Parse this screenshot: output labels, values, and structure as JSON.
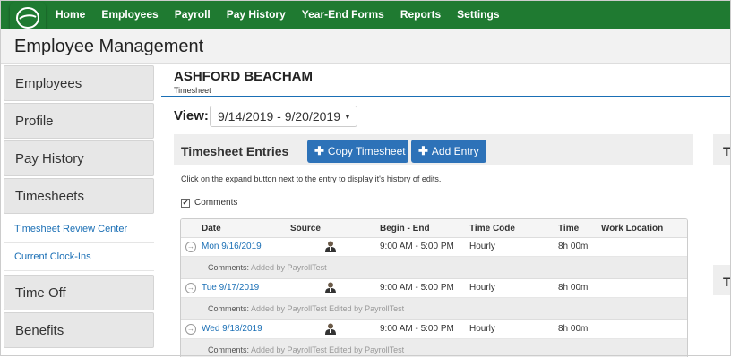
{
  "nav": [
    "Home",
    "Employees",
    "Payroll",
    "Pay History",
    "Year-End Forms",
    "Reports",
    "Settings"
  ],
  "page_title": "Employee Management",
  "sidebar": {
    "items": [
      {
        "label": "Employees"
      },
      {
        "label": "Profile"
      },
      {
        "label": "Pay History"
      },
      {
        "label": "Timesheets"
      }
    ],
    "subitems": [
      {
        "label": "Timesheet Review Center"
      },
      {
        "label": "Current Clock-Ins"
      }
    ],
    "items_after": [
      {
        "label": "Time Off"
      },
      {
        "label": "Benefits"
      }
    ]
  },
  "employee": {
    "name": "ASHFORD BEACHAM",
    "section": "Timesheet"
  },
  "view": {
    "label": "View:",
    "range": "9/14/2019 - 9/20/2019"
  },
  "entries_panel": {
    "title": "Timesheet Entries",
    "copy_label": "Copy Timesheet",
    "add_label": "Add Entry",
    "right_title_1": "T",
    "right_title_2": "T"
  },
  "hint": "Click on the expand button next to the entry to display it's history of edits.",
  "comments_label": "Comments",
  "table": {
    "headers": [
      "Date",
      "Source",
      "Begin - End",
      "Time Code",
      "Time",
      "Work Location"
    ],
    "rows": [
      {
        "date": "Mon 9/16/2019",
        "begin_end": "9:00 AM - 5:00 PM",
        "time_code": "Hourly",
        "time": "8h 00m",
        "location": "",
        "comment_label": "Comments:",
        "comment": "Added by PayrollTest"
      },
      {
        "date": "Tue 9/17/2019",
        "begin_end": "9:00 AM - 5:00 PM",
        "time_code": "Hourly",
        "time": "8h 00m",
        "location": "",
        "comment_label": "Comments:",
        "comment": "Added by PayrollTest Edited by PayrollTest"
      },
      {
        "date": "Wed 9/18/2019",
        "begin_end": "9:00 AM - 5:00 PM",
        "time_code": "Hourly",
        "time": "8h 00m",
        "location": "",
        "comment_label": "Comments:",
        "comment": "Added by PayrollTest Edited by PayrollTest"
      }
    ]
  },
  "colors": {
    "nav_green": "#1f7a31",
    "link_blue": "#1a6fb5",
    "button_blue": "#2d72b8"
  }
}
